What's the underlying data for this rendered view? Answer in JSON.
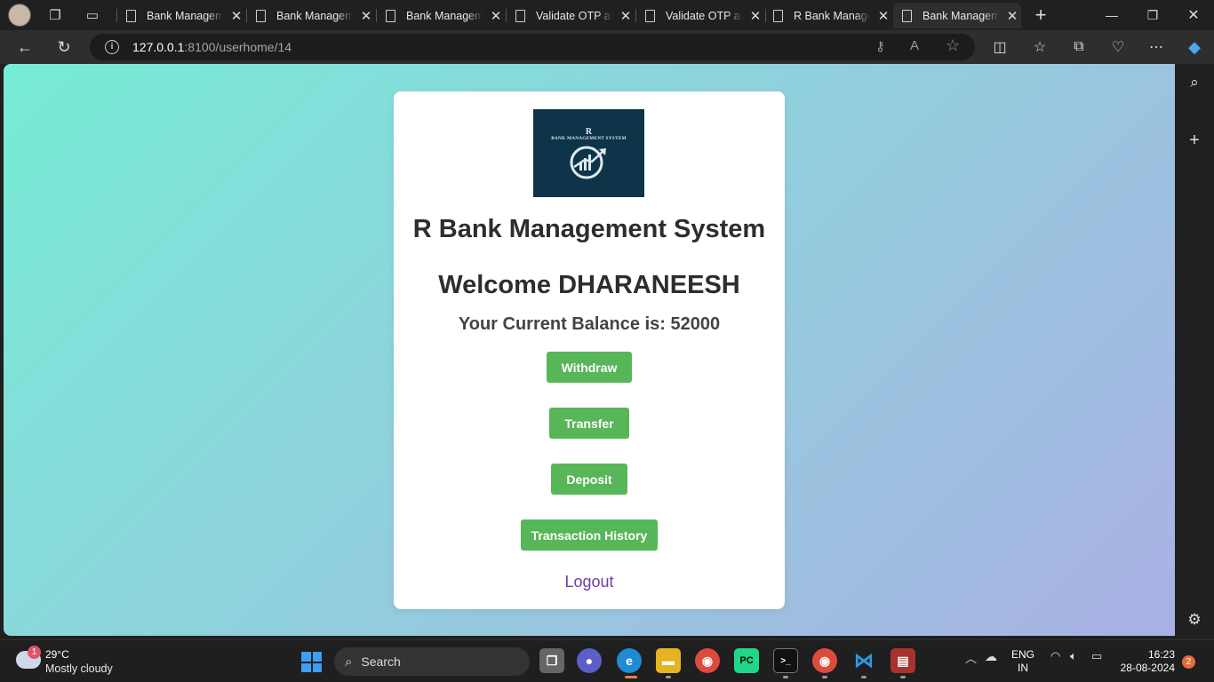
{
  "browser": {
    "tabs": [
      {
        "title": "Bank Management System"
      },
      {
        "title": "Bank Management System"
      },
      {
        "title": "Bank Management System"
      },
      {
        "title": "Validate OTP and"
      },
      {
        "title": "Validate OTP and"
      },
      {
        "title": "R Bank Management"
      },
      {
        "title": "Bank Management System"
      }
    ],
    "url_host": "127.0.0.1",
    "url_path": ":8100/userhome/14"
  },
  "page": {
    "logo_line1": "R",
    "logo_line2": "BANK MANAGEMENT SYSTEM",
    "bank_title": "R Bank Management System",
    "welcome": "Welcome DHARANEESH",
    "balance": "Your Current Balance is: 52000",
    "buttons": {
      "withdraw": "Withdraw",
      "transfer": "Transfer",
      "deposit": "Deposit",
      "history": "Transaction History"
    },
    "logout": "Logout"
  },
  "taskbar": {
    "weather_badge": "1",
    "temperature": "29°C",
    "condition": "Mostly cloudy",
    "search_label": "Search",
    "lang_line1": "ENG",
    "lang_line2": "IN",
    "time": "16:23",
    "date": "28-08-2024",
    "notification_count": "2"
  },
  "colors": {
    "button_green": "#57b657",
    "logout_purple": "#6d3fa1",
    "logo_bg": "#0d3449"
  }
}
